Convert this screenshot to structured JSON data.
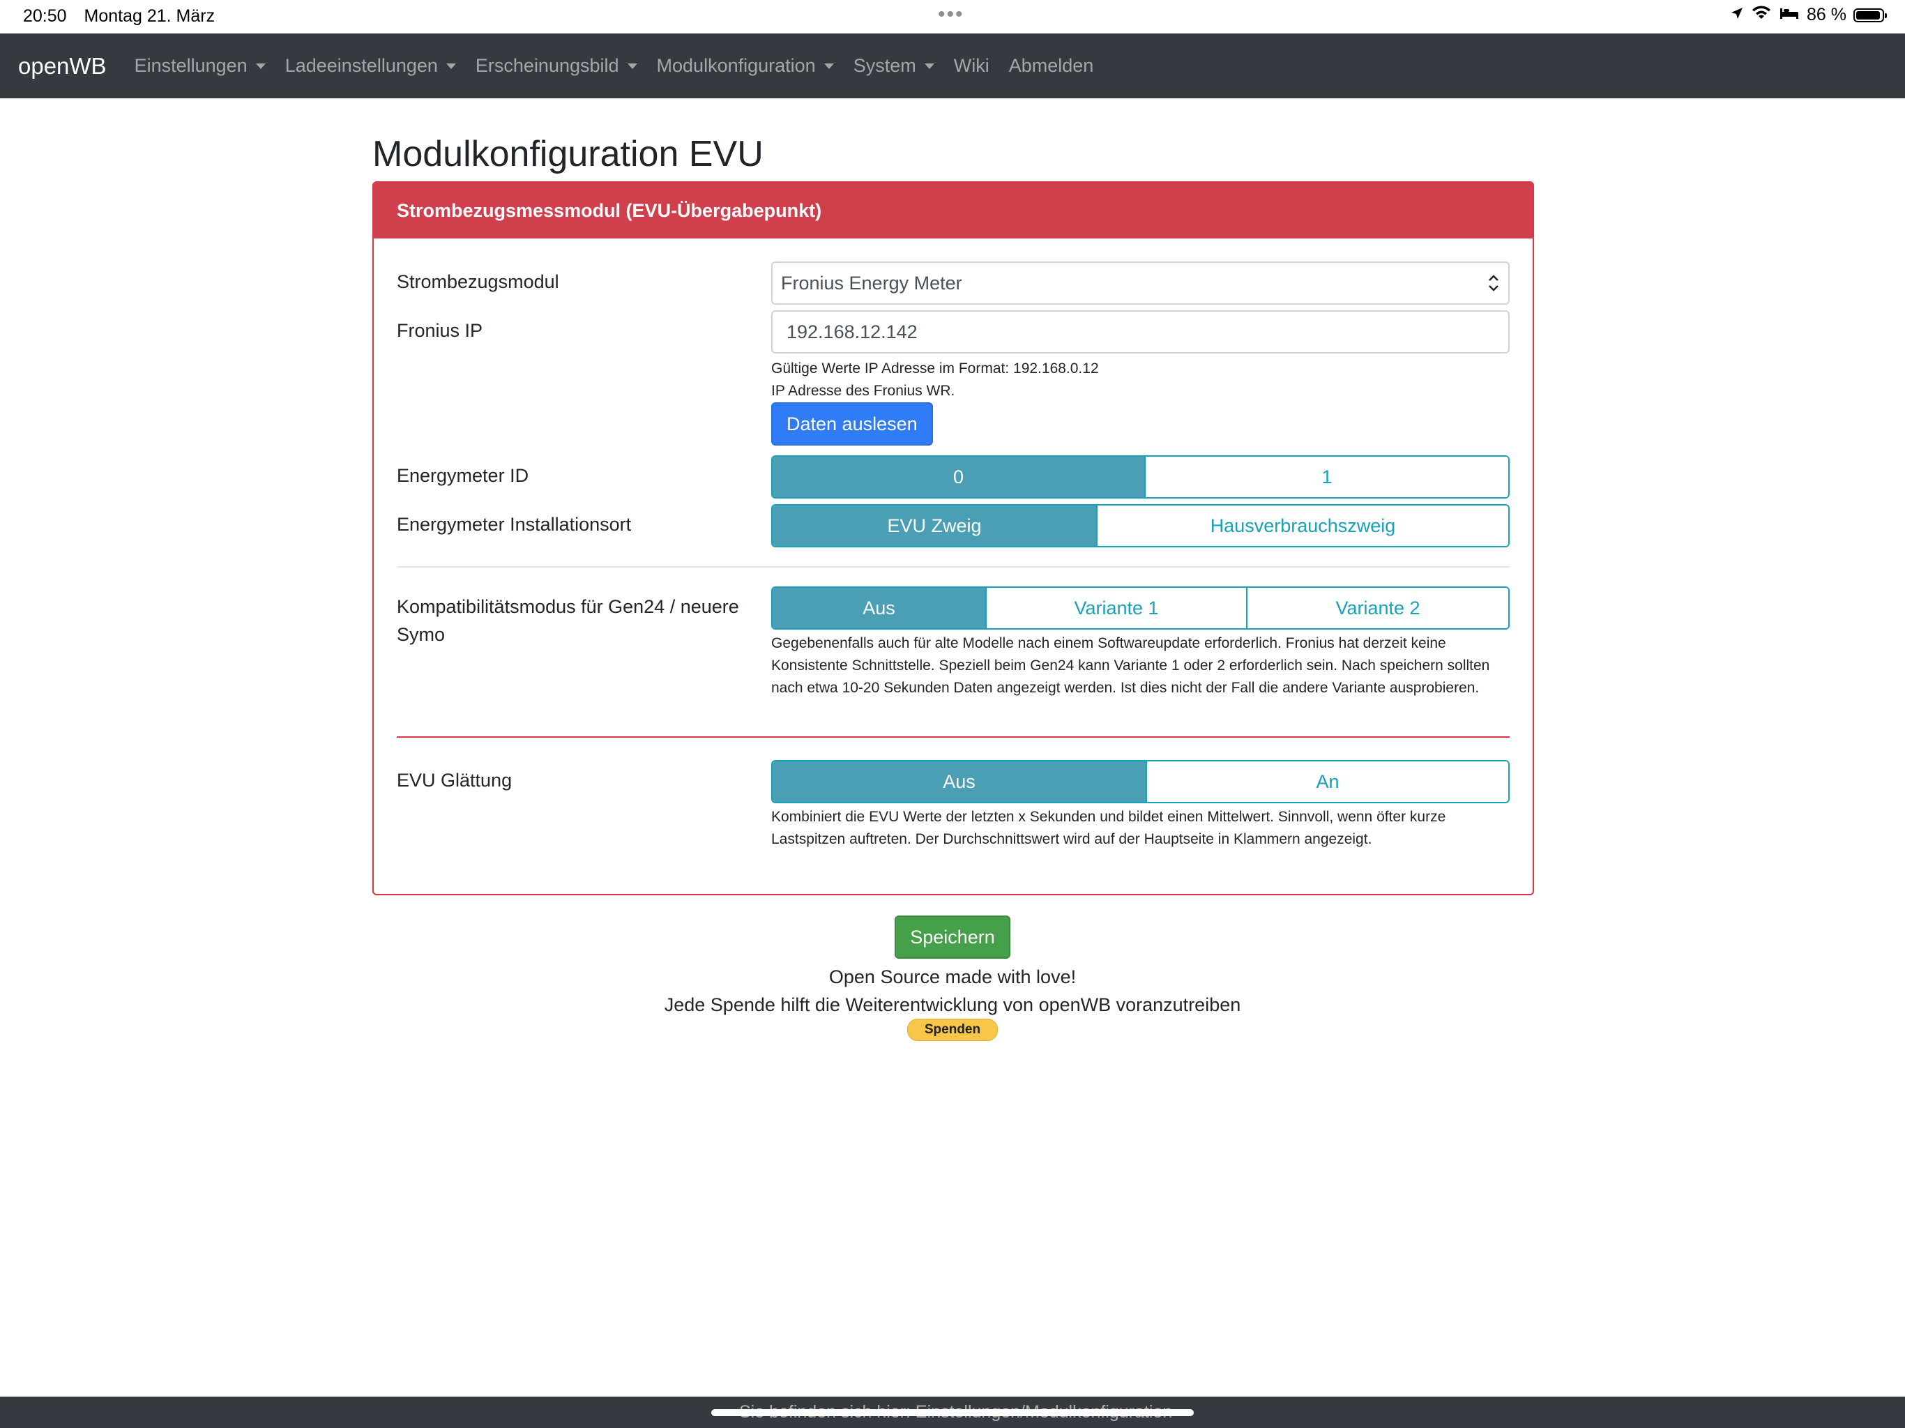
{
  "status_bar": {
    "time": "20:50",
    "date": "Montag 21. März",
    "battery": "86 %",
    "battery_fraction": 0.86,
    "icons": [
      "location-arrow-icon",
      "wifi-icon",
      "bed-icon",
      "battery-icon"
    ]
  },
  "navbar": {
    "brand": "openWB",
    "items": [
      {
        "label": "Einstellungen",
        "dropdown": true
      },
      {
        "label": "Ladeeinstellungen",
        "dropdown": true
      },
      {
        "label": "Erscheinungsbild",
        "dropdown": true
      },
      {
        "label": "Modulkonfiguration",
        "dropdown": true
      },
      {
        "label": "System",
        "dropdown": true
      },
      {
        "label": "Wiki",
        "dropdown": false
      },
      {
        "label": "Abmelden",
        "dropdown": false
      }
    ]
  },
  "page": {
    "title": "Modulkonfiguration EVU"
  },
  "card": {
    "header": "Strombezugsmessmodul (EVU-Übergabepunkt)",
    "strombezugsmodul": {
      "label": "Strombezugsmodul",
      "selected": "Fronius Energy Meter"
    },
    "fronius_ip": {
      "label": "Fronius IP",
      "value": "192.168.12.142",
      "help1": "Gültige Werte IP Adresse im Format: 192.168.0.12",
      "help2": "IP Adresse des Fronius WR.",
      "button": "Daten auslesen"
    },
    "energymeter_id": {
      "label": "Energymeter ID",
      "options": [
        "0",
        "1"
      ],
      "active": "0"
    },
    "installationsort": {
      "label": "Energymeter Installationsort",
      "options": [
        "EVU Zweig",
        "Hausverbrauchszweig"
      ],
      "active": "EVU Zweig"
    },
    "kompatibilitaet": {
      "label": "Kompatibilitätsmodus für Gen24 / neuere Symo",
      "options": [
        "Aus",
        "Variante 1",
        "Variante 2"
      ],
      "active": "Aus",
      "help": "Gegebenenfalls auch für alte Modelle nach einem Softwareupdate erforderlich. Fronius hat derzeit keine Konsistente Schnittstelle. Speziell beim Gen24 kann Variante 1 oder 2 erforderlich sein. Nach speichern sollten nach etwa 10-20 Sekunden Daten angezeigt werden. Ist dies nicht der Fall die andere Variante ausprobieren."
    },
    "glaettung": {
      "label": "EVU Glättung",
      "options": [
        "Aus",
        "An"
      ],
      "active": "Aus",
      "help": "Kombiniert die EVU Werte der letzten x Sekunden und bildet einen Mittelwert. Sinnvoll, wenn öfter kurze Lastspitzen auftreten. Der Durchschnittswert wird auf der Hauptseite in Klammern angezeigt."
    }
  },
  "footer": {
    "save_button": "Speichern",
    "line1": "Open Source made with love!",
    "line2": "Jede Spende hilft die Weiterentwicklung von openWB voranzutreiben",
    "donate_button": "Spenden",
    "bottom_text": "Sie befinden sich hier: Einstellungen/Modulkonfiguration"
  },
  "colors": {
    "navbar_bg": "#343a40",
    "card_header": "#cf3f4c",
    "card_border": "#dc3545",
    "primary": "#2f7cf6",
    "info": "#17a2b8",
    "info_active": "#4a9fb5",
    "success": "#45a049",
    "donate": "#f8c649"
  }
}
